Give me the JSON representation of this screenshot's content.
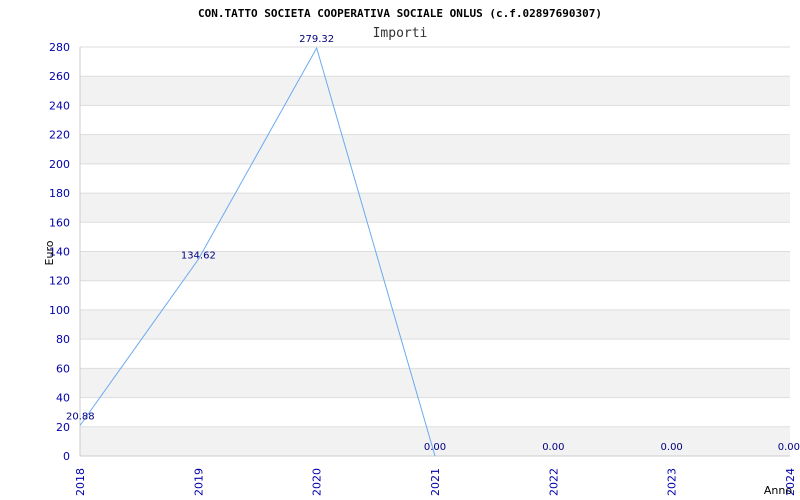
{
  "chart_data": {
    "type": "line",
    "title": "CON.TATTO SOCIETA COOPERATIVA SOCIALE ONLUS (c.f.02897690307)",
    "subtitle": "Importi",
    "xlabel": "Anno",
    "ylabel": "Euro",
    "x": [
      "2018",
      "2019",
      "2020",
      "2021",
      "2022",
      "2023",
      "2024"
    ],
    "series": [
      {
        "values": [
          20.88,
          134.62,
          279.32,
          0.0,
          0.0,
          0.0,
          0.0
        ],
        "labels": [
          "20.88",
          "134.62",
          "279.32",
          "0.00",
          "0.00",
          "0.00",
          "0.00"
        ]
      }
    ],
    "ylim": [
      0,
      280
    ],
    "yticks": [
      0,
      20,
      40,
      60,
      80,
      100,
      120,
      140,
      160,
      180,
      200,
      220,
      240,
      260,
      280
    ],
    "line_count": 4,
    "grid": true,
    "colors": {
      "line": "#6aaaf0",
      "band": "#f2f2f2",
      "grid": "#dddddd",
      "tick": "#0000aa"
    }
  }
}
